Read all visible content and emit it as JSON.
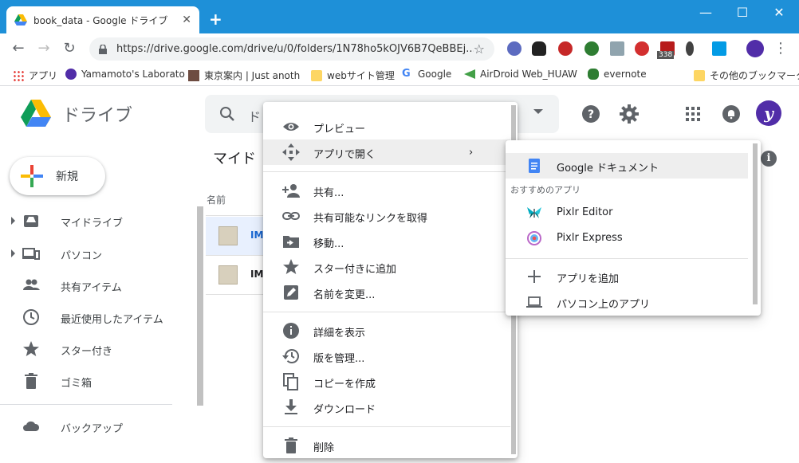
{
  "browser": {
    "tab_title": "book_data - Google ドライブ",
    "url": "https://drive.google.com/drive/u/0/folders/1N78ho5kOJV6B7QeBBEj...",
    "extension_badge": "338",
    "bookmarks": [
      "アプリ",
      "Yamamoto's Laborato",
      "東京案内 | Just anoth",
      "webサイト管理",
      "Google",
      "AirDroid Web_HUAW",
      "evernote",
      "その他のブックマーク"
    ]
  },
  "drive": {
    "logo_text": "ドライブ",
    "search_placeholder": "ド",
    "avatar_letter": "y",
    "new_label": "新規",
    "nav": [
      "マイドライブ",
      "パソコン",
      "共有アイテム",
      "最近使用したアイテム",
      "スター付き",
      "ゴミ箱",
      "バックアップ"
    ],
    "main_title": "マイド",
    "column_name": "名前",
    "files": [
      "IM",
      "IM"
    ]
  },
  "context_menu": {
    "items": [
      "プレビュー",
      "アプリで開く",
      "共有...",
      "共有可能なリンクを取得",
      "移動...",
      "スター付きに追加",
      "名前を変更...",
      "詳細を表示",
      "版を管理...",
      "コピーを作成",
      "ダウンロード",
      "削除"
    ],
    "submenu_arrow": "›"
  },
  "open_with": {
    "google_docs": "Google ドキュメント",
    "heading": "おすすめのアプリ",
    "apps": [
      "Pixlr Editor",
      "Pixlr Express"
    ],
    "add_app": "アプリを追加",
    "desktop_app": "パソコン上のアプリ"
  },
  "colors": {
    "titlebar": "#1e90d8",
    "docs_blue": "#4285f4",
    "avatar": "#512da8"
  }
}
